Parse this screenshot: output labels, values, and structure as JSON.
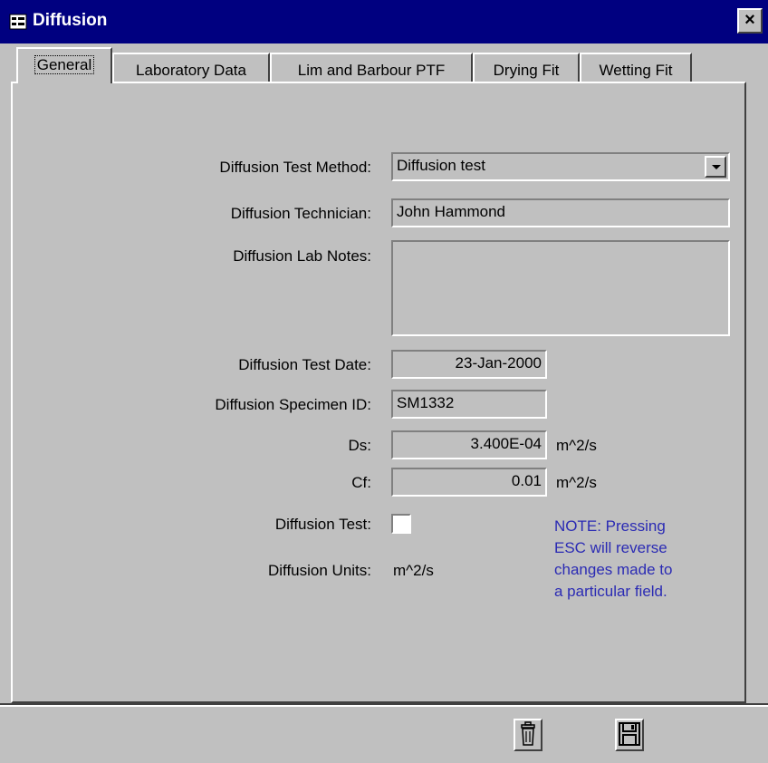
{
  "window": {
    "title": "Diffusion",
    "close_label": "×"
  },
  "tabs": [
    {
      "label": "General",
      "active": true
    },
    {
      "label": "Laboratory Data",
      "active": false
    },
    {
      "label": "Lim and Barbour PTF",
      "active": false
    },
    {
      "label": "Drying Fit",
      "active": false
    },
    {
      "label": "Wetting Fit",
      "active": false
    }
  ],
  "form": {
    "test_method": {
      "label": "Diffusion Test Method:",
      "value": "Diffusion test"
    },
    "technician": {
      "label": "Diffusion Technician:",
      "value": "John Hammond"
    },
    "lab_notes": {
      "label": "Diffusion Lab Notes:",
      "value": ""
    },
    "test_date": {
      "label": "Diffusion Test Date:",
      "value": "23-Jan-2000"
    },
    "specimen_id": {
      "label": "Diffusion Specimen ID:",
      "value": "SM1332"
    },
    "ds": {
      "label": "Ds:",
      "value": "3.400E-04",
      "unit": "m^2/s"
    },
    "cf": {
      "label": "Cf:",
      "value": "0.01",
      "unit": "m^2/s"
    },
    "diffusion_test": {
      "label": "Diffusion Test:",
      "checked": false
    },
    "units": {
      "label": "Diffusion Units:",
      "value": "m^2/s"
    }
  },
  "note": {
    "lines": [
      "NOTE: Pressing",
      "ESC will reverse",
      "changes made to",
      "a particular field."
    ],
    "color": "#2b2bb4"
  },
  "footer": {
    "delete_icon": "trash-icon",
    "save_icon": "floppy-disk-icon"
  }
}
